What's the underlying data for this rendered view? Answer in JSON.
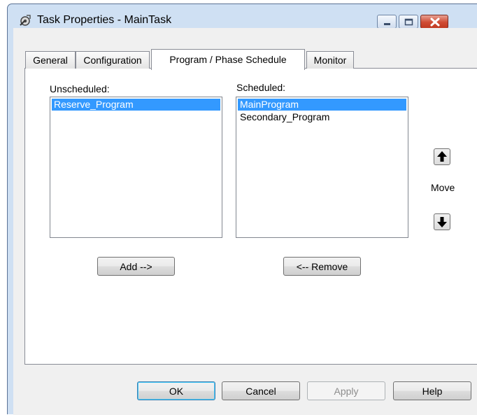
{
  "window": {
    "title": "Task Properties - MainTask"
  },
  "tabs": [
    {
      "label": "General"
    },
    {
      "label": "Configuration"
    },
    {
      "label": "Program / Phase Schedule"
    },
    {
      "label": "Monitor"
    }
  ],
  "active_tab": "Program / Phase Schedule",
  "schedule": {
    "unscheduled_label": "Unscheduled:",
    "unscheduled_items": [
      "Reserve_Program"
    ],
    "scheduled_label": "Scheduled:",
    "scheduled_items": [
      "MainProgram",
      "Secondary_Program"
    ],
    "move_label": "Move",
    "add_button": "Add -->",
    "remove_button": "<-- Remove"
  },
  "footer": {
    "ok": "OK",
    "cancel": "Cancel",
    "apply": "Apply",
    "help": "Help"
  },
  "icons": {
    "app": "task-properties-icon",
    "minimize": "minimize-icon",
    "maximize": "maximize-icon",
    "close": "close-icon",
    "move_up": "arrow-up-icon",
    "move_down": "arrow-down-icon"
  },
  "colors": {
    "selection": "#3399ff",
    "close_button": "#c9432c",
    "window_frame": "#cfe0f3"
  }
}
